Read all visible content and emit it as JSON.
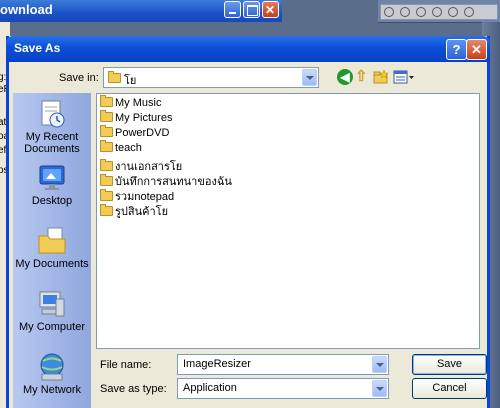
{
  "background": {
    "window_title": "ownload",
    "left_strip_text": [
      "g:",
      "eR",
      "ate",
      "oa",
      "efe",
      "os"
    ]
  },
  "dialog": {
    "title": "Save As",
    "help_button": "?",
    "close_button": "✕",
    "save_in_label": "Save in:",
    "save_in_value": "โย",
    "places": [
      {
        "label": "My Recent Documents",
        "icon": "recent-documents-icon"
      },
      {
        "label": "Desktop",
        "icon": "desktop-icon"
      },
      {
        "label": "My Documents",
        "icon": "my-documents-icon"
      },
      {
        "label": "My Computer",
        "icon": "my-computer-icon"
      },
      {
        "label": "My Network",
        "icon": "my-network-icon"
      }
    ],
    "files": [
      {
        "name": "My Music",
        "icon": "special-folder-icon"
      },
      {
        "name": "My Pictures",
        "icon": "special-folder-icon"
      },
      {
        "name": "PowerDVD",
        "icon": "folder-icon"
      },
      {
        "name": "teach",
        "icon": "folder-icon"
      },
      {
        "name": "งานเอกสารโย",
        "icon": "folder-icon"
      },
      {
        "name": "บันทึกการสนทนาของฉัน",
        "icon": "folder-icon"
      },
      {
        "name": "รวมnotepad",
        "icon": "folder-icon"
      },
      {
        "name": "รูปสินค้าโย",
        "icon": "folder-icon"
      }
    ],
    "file_name_label": "File name:",
    "file_name_value": "ImageResizer",
    "save_as_type_label": "Save as type:",
    "save_as_type_value": "Application",
    "save_button": "Save",
    "cancel_button": "Cancel"
  },
  "colors": {
    "titlebar": "#0a4fd8",
    "dialog_bg": "#ece9d8",
    "places_bg": "#a3b7e8"
  }
}
